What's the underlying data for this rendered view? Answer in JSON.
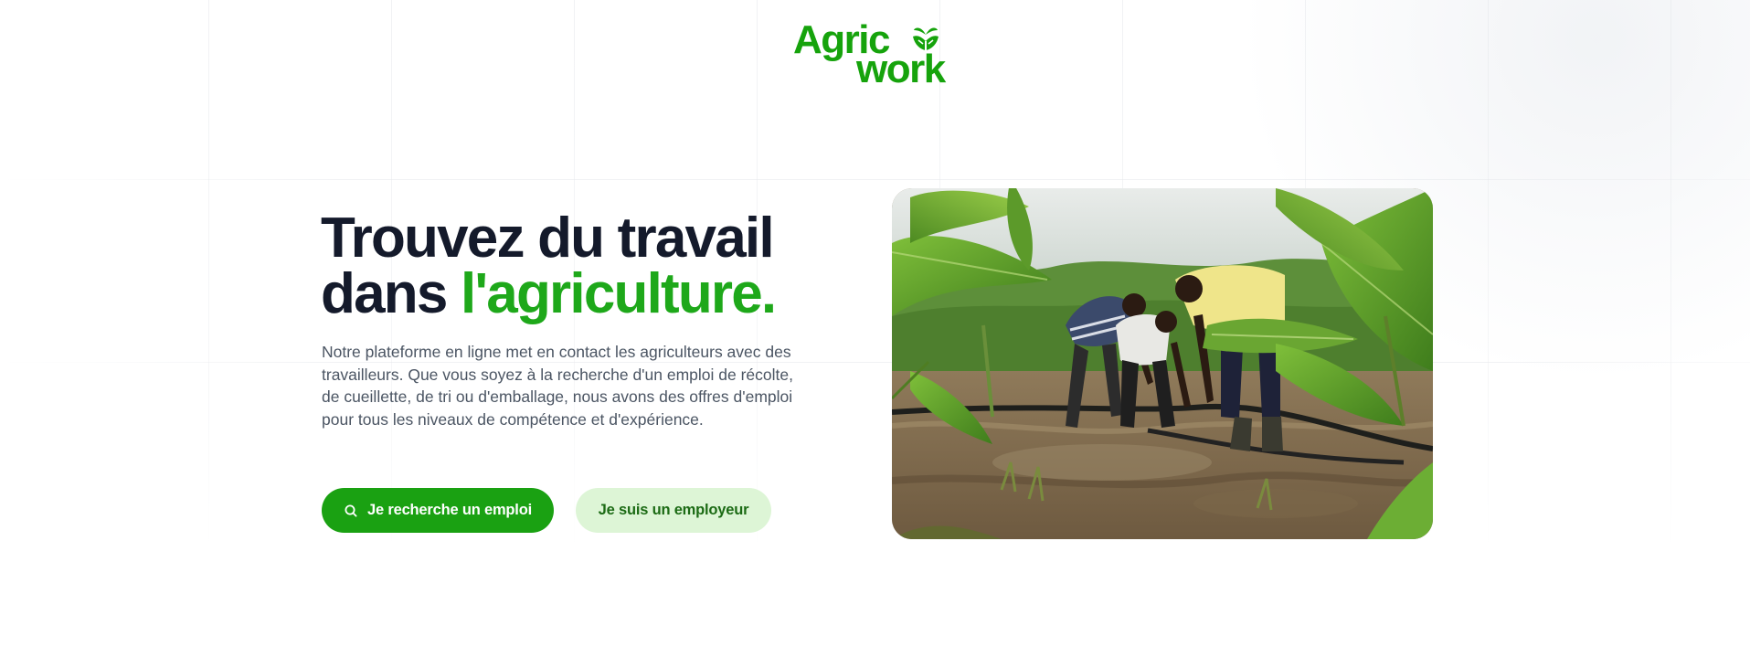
{
  "logo": {
    "line1": "Agric",
    "line2": "work",
    "brand_color": "#16a30c",
    "icon": "sprout-hands-icon"
  },
  "hero": {
    "title_line1": "Trouvez du travail",
    "title_line2_prefix": "dans ",
    "title_line2_accent": "l'agriculture.",
    "accent_color": "#1ea81a",
    "description": "Notre plateforme en ligne met en contact les agriculteurs avec des travailleurs. Que vous soyez à la recherche d'un emploi de récolte, de cueillette, de tri ou d'emballage, nous avons des offres d'emploi pour tous les niveaux de compétence et d'expérience."
  },
  "actions": {
    "job_seeker_label": "Je recherche un emploi",
    "job_seeker_icon": "search-icon",
    "employer_label": "Je suis un employeur"
  },
  "image": {
    "subject": "farm-workers-photo"
  }
}
